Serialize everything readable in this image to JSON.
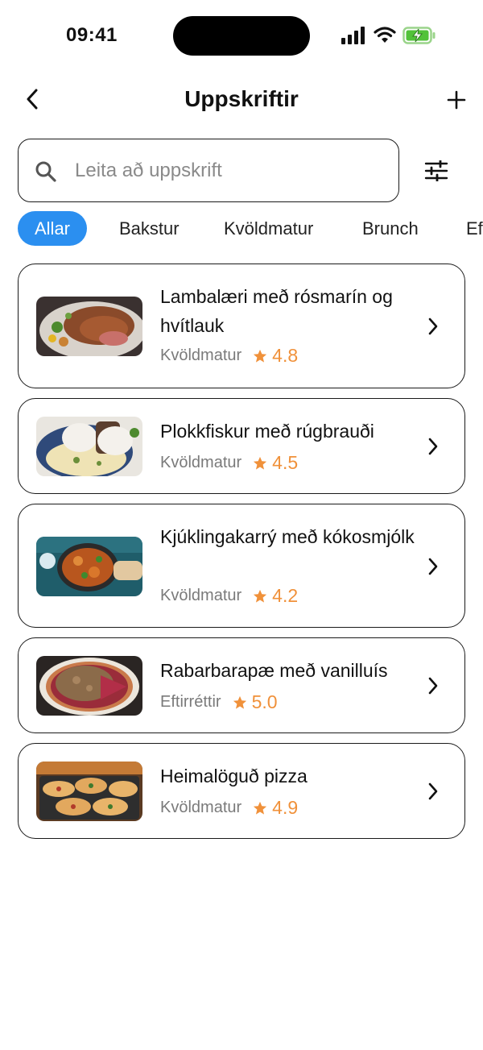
{
  "status_bar": {
    "time": "09:41"
  },
  "header": {
    "title": "Uppskriftir"
  },
  "search": {
    "placeholder": "Leita að uppskrift",
    "value": ""
  },
  "categories": [
    {
      "label": "Allar",
      "active": true
    },
    {
      "label": "Bakstur",
      "active": false
    },
    {
      "label": "Kvöldmatur",
      "active": false
    },
    {
      "label": "Brunch",
      "active": false
    },
    {
      "label": "Eftirréttir",
      "active": false
    }
  ],
  "colors": {
    "accent": "#2b8ff0",
    "rating": "#f0913a",
    "border": "#1a1a1a",
    "muted": "#7a7a7a"
  },
  "recipes": [
    {
      "title": "Lambalæri með rósmarín og hvítlauk",
      "category": "Kvöldmatur",
      "rating": "4.8",
      "image": "roast-lamb-image"
    },
    {
      "title": "Plokkfiskur með rúgbrauði",
      "category": "Kvöldmatur",
      "rating": "4.5",
      "image": "fish-stew-image"
    },
    {
      "title": "Kjúklingakarrý með kókosmjólk",
      "category": "Kvöldmatur",
      "rating": "4.2",
      "image": "chicken-curry-image"
    },
    {
      "title": "Rabarbarapæ með vanilluís",
      "category": "Eftirréttir",
      "rating": "5.0",
      "image": "rhubarb-pie-image"
    },
    {
      "title": "Heimalöguð pizza",
      "category": "Kvöldmatur",
      "rating": "4.9",
      "image": "homemade-pizza-image"
    }
  ]
}
